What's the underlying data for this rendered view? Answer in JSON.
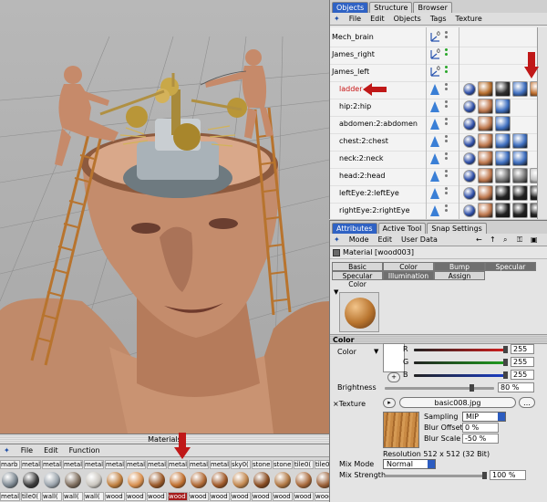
{
  "materials_panel": {
    "title": "Materials",
    "menu": [
      "File",
      "Edit",
      "Function"
    ],
    "top_row": [
      "marb",
      "metal",
      "metal",
      "metal",
      "metal",
      "metal",
      "metal",
      "metal",
      "metal",
      "metal",
      "metal",
      "sky0(",
      "stone",
      "stone",
      "tile0(",
      "tile0("
    ],
    "items": [
      {
        "label": "metal",
        "color": "#7d8891"
      },
      {
        "label": "tile0(",
        "color": "#3d3d3d"
      },
      {
        "label": "wall(",
        "color": "#9aa3ab"
      },
      {
        "label": "wall(",
        "color": "#7f6f5f"
      },
      {
        "label": "wall(",
        "color": "#c9c5be"
      },
      {
        "label": "wood",
        "color": "#c08040"
      },
      {
        "label": "wood",
        "color": "#d89050"
      },
      {
        "label": "wood",
        "color": "#9a5a2a"
      },
      {
        "label": "wood",
        "color": "#c07030",
        "selected": true
      },
      {
        "label": "wood",
        "color": "#b06a36"
      },
      {
        "label": "wood",
        "color": "#a05a2a"
      },
      {
        "label": "wood",
        "color": "#c28850"
      },
      {
        "label": "wood",
        "color": "#8a4e24"
      },
      {
        "label": "wood",
        "color": "#b07844"
      },
      {
        "label": "wood",
        "color": "#a86a3c"
      },
      {
        "label": "wood",
        "color": "#9a6038"
      }
    ]
  },
  "object_manager": {
    "tabs": [
      "Objects",
      "Structure",
      "Browser"
    ],
    "menu": [
      "File",
      "Edit",
      "Objects",
      "Tags",
      "Texture"
    ],
    "rows": [
      {
        "name": "Mech_brain",
        "kind": "null",
        "dots": "gray",
        "tags": []
      },
      {
        "name": "James_right",
        "kind": "null",
        "dots": "green",
        "tags": []
      },
      {
        "name": "James_left",
        "kind": "null",
        "dots": "green",
        "tags": []
      },
      {
        "name": "ladder",
        "kind": "bone",
        "dots": "gray",
        "highlight": true,
        "tags": [
          "#3050a8",
          "#b8702e",
          "#303030",
          "#4070c0",
          "#c07030"
        ]
      },
      {
        "name": "hip:2:hip",
        "kind": "bone",
        "dots": "gray",
        "tags": [
          "#3050a8",
          "#c07a50",
          "#4070c0"
        ]
      },
      {
        "name": "abdomen:2:abdomen",
        "kind": "bone",
        "dots": "gray",
        "tags": [
          "#3050a8",
          "#c07a50",
          "#4070c0"
        ]
      },
      {
        "name": "chest:2:chest",
        "kind": "bone",
        "dots": "gray",
        "tags": [
          "#3050a8",
          "#c07a50",
          "#4070c0",
          "#4070c0"
        ]
      },
      {
        "name": "neck:2:neck",
        "kind": "bone",
        "dots": "gray",
        "tags": [
          "#3050a8",
          "#c07a50",
          "#4070c0",
          "#4070c0"
        ]
      },
      {
        "name": "head:2:head",
        "kind": "bone",
        "dots": "gray",
        "tags": [
          "#3050a8",
          "#c07a50",
          "#777777",
          "#777777",
          "#c0c0c0",
          "#404040"
        ]
      },
      {
        "name": "leftEye:2:leftEye",
        "kind": "bone",
        "dots": "gray",
        "tags": [
          "#3050a8",
          "#c07a50",
          "#222222",
          "#222222",
          "#222222"
        ]
      },
      {
        "name": "rightEye:2:rightEye",
        "kind": "bone",
        "dots": "gray",
        "tags": [
          "#3050a8",
          "#c07a50",
          "#222222",
          "#222222",
          "#222222"
        ]
      }
    ]
  },
  "attribute_manager": {
    "tabs": [
      "Attributes",
      "Active Tool",
      "Snap Settings"
    ],
    "menu": [
      "Mode",
      "Edit",
      "User Data"
    ],
    "material_name": "Material [wood003]",
    "buttons_row1": [
      "Basic",
      "Color",
      "Bump",
      "Specular"
    ],
    "buttons_row2": [
      "Specular Color",
      "Illumination",
      "Assign",
      ""
    ],
    "section": "Color",
    "color_label": "Color",
    "r_label": "R",
    "g_label": "G",
    "b_label": "B",
    "r_value": "255",
    "g_value": "255",
    "b_value": "255",
    "brightness_label": "Brightness",
    "brightness_value": "80 %",
    "brightness_level": 0.8,
    "texture_label": "Texture",
    "texture_file": "basic008.jpg",
    "sampling_label": "Sampling",
    "sampling_value": "MIP",
    "blur_offset_label": "Blur Offset",
    "blur_offset_value": "0 %",
    "blur_scale_label": "Blur Scale",
    "blur_scale_value": "-50 %",
    "resolution": "Resolution 512 x 512 (32 Bit)",
    "mix_mode_label": "Mix Mode",
    "mix_mode_value": "Normal",
    "mix_strength_label": "Mix Strength",
    "mix_strength_value": "100 %",
    "mix_strength_level": 1.0
  },
  "colors": {
    "accent_blue": "#2f62c4",
    "selection_red": "#a51b1b",
    "arrow_red": "#c01818",
    "wood": "#b8742e",
    "skin": "#c99372"
  }
}
